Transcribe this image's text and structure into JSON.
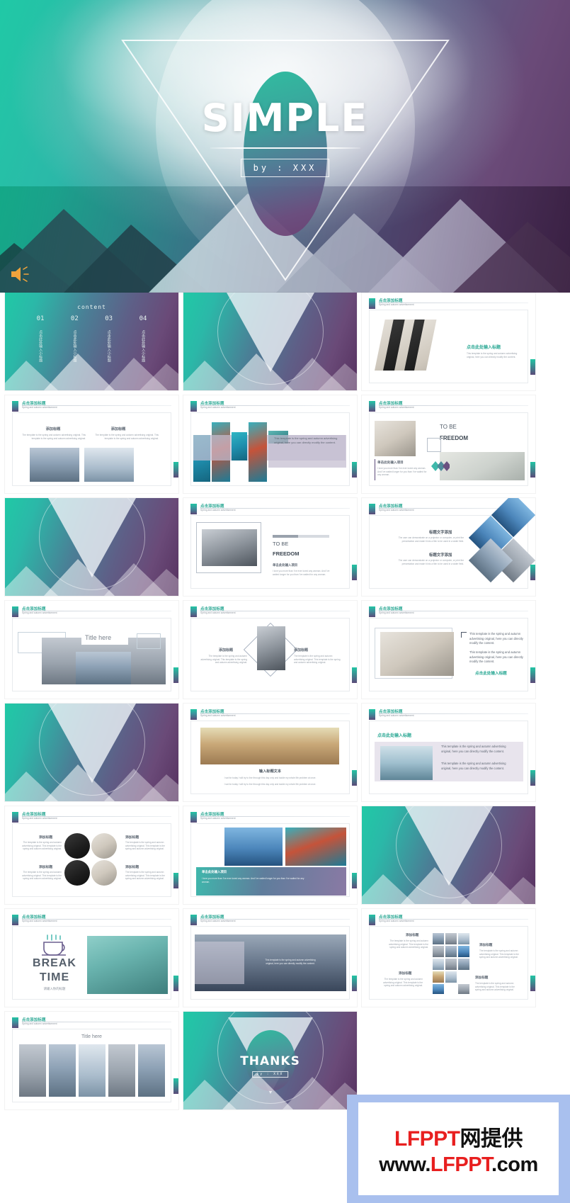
{
  "cover": {
    "title": "SIMPLE",
    "byline": "by : XXX",
    "speaker_icon": "speaker-icon"
  },
  "slide_header": {
    "title": "点击添加标题",
    "subtitle": "Spring and autumn advertisement"
  },
  "toc": {
    "label": "content",
    "items": [
      {
        "num": "01",
        "text": "点击此处输入小标题"
      },
      {
        "num": "02",
        "text": "点击此处输入小标题"
      },
      {
        "num": "03",
        "text": "点击此处输入小标题"
      },
      {
        "num": "04",
        "text": "点击此处输入小标题"
      }
    ]
  },
  "common": {
    "add_title": "添加标题",
    "click_input_title": "点击此处输入标题",
    "title_text_add": "标题文字添加",
    "single_click_input": "单击此处输入项目",
    "body_en": "This template is the spring and autumn advertising original, here you can directly modify the content.",
    "body_en_2": "The template is the spring and autumn advertising original. This template is the spring and autumn advertising original.",
    "body_en_3": "The user can demonstrate on a projector or computer, or print the presentation and make it into a film to be used in a wider field.",
    "to_be": "TO BE",
    "freedom": "FREEDOM",
    "title_here": "Title here",
    "break_time_1": "BREAK",
    "break_time_2": "TIME",
    "break_sub": "请输入你的标题",
    "input_title_text": "输入标题文本",
    "quote_line": "I sat for today I will try to live through this day only and tackle my whole life problem at once.",
    "love_line": "I love you more than I've ever loved any woman. And I've waited longer for you than I've waited for any woman.",
    "thanks": "THANKS",
    "thanks_by": "by : XXX"
  },
  "watermark": {
    "line1_red": "LFPPT",
    "line1_black": "网提供",
    "line2_pre": "www.",
    "line2_red": "LFPPT",
    "line2_post": ".com",
    "red": "#e81f1f",
    "border": "#a9c0ee"
  },
  "theme": {
    "teal": "#22c5a4",
    "purple": "#5b4a79",
    "title_teal": "#2aa894",
    "body_gray": "#9aa2ab"
  }
}
